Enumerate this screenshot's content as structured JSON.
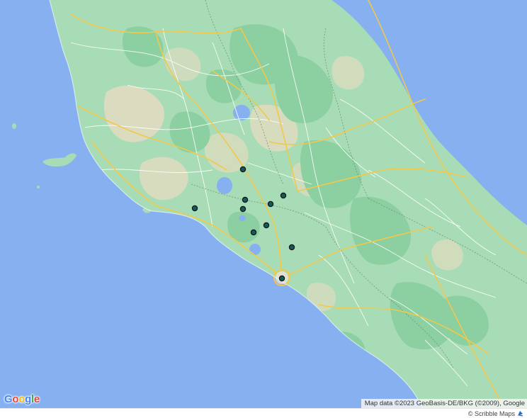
{
  "map": {
    "google_logo": [
      "G",
      "o",
      "o",
      "g",
      "l",
      "e"
    ],
    "google_logo_colors": [
      "#4285F4",
      "#EA4335",
      "#FBBC05",
      "#4285F4",
      "#34A853",
      "#EA4335"
    ],
    "attribution": "Map data ©2023 GeoBasis-DE/BKG (©2009), Google",
    "colors": {
      "sea": "#86b0f0",
      "land": "#a8dcb6",
      "forest": "#8ccfa0",
      "agri": "#ecdcc2",
      "major_road": "#f2c84b",
      "minor_road": "#ffffff",
      "lake": "#86b0f0",
      "marker_fill": "#125b5c",
      "marker_stroke": "#111111"
    },
    "markers": [
      {
        "name": "location-marker-1"
      },
      {
        "name": "location-marker-2"
      },
      {
        "name": "location-marker-3"
      },
      {
        "name": "location-marker-4"
      },
      {
        "name": "location-marker-5"
      },
      {
        "name": "location-marker-6"
      },
      {
        "name": "location-marker-7"
      },
      {
        "name": "location-marker-8"
      },
      {
        "name": "location-marker-9"
      },
      {
        "name": "location-marker-10"
      }
    ]
  },
  "footer": {
    "credit": "© Scribble Maps",
    "credit_icon": "scribble-maps-logo-icon"
  }
}
